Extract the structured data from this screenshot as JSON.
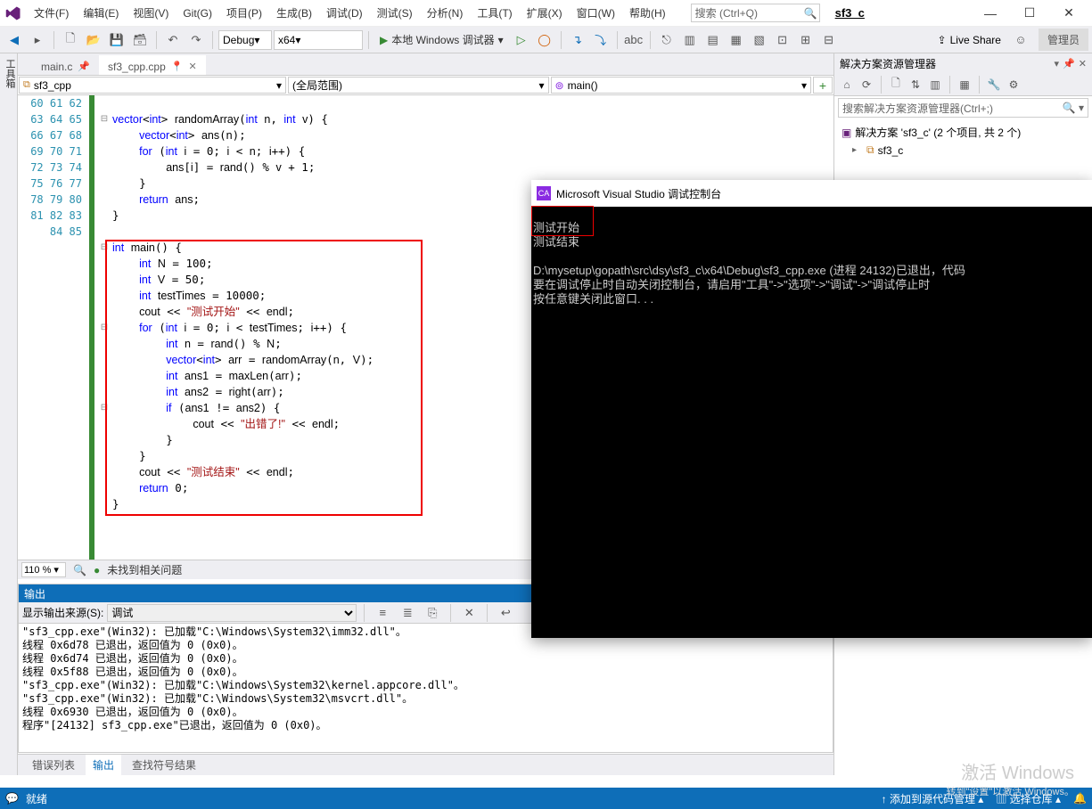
{
  "menu": {
    "file": "文件(F)",
    "edit": "编辑(E)",
    "view": "视图(V)",
    "git": "Git(G)",
    "project": "项目(P)",
    "build": "生成(B)",
    "debug": "调试(D)",
    "test": "测试(S)",
    "analyze": "分析(N)",
    "tools": "工具(T)",
    "extensions": "扩展(X)",
    "window": "窗口(W)",
    "help": "帮助(H)"
  },
  "titlebar": {
    "search_placeholder": "搜索 (Ctrl+Q)",
    "solution_name": "sf3_c"
  },
  "toolbar": {
    "config": "Debug",
    "platform": "x64",
    "run": "本地 Windows 调试器",
    "live_share": "Live Share",
    "admin": "管理员"
  },
  "tabs": {
    "pinned": "main.c",
    "active": "sf3_cpp.cpp"
  },
  "navbar": {
    "project": "sf3_cpp",
    "scope": "(全局范围)",
    "func": "main()"
  },
  "editor": {
    "line_start": 60,
    "line_end": 85,
    "zoom": "110 %",
    "status": "未找到相关问题"
  },
  "code_lines": [
    "",
    "vector<int> randomArray(int n, int v) {",
    "    vector<int> ans(n);",
    "    for (int i = 0; i < n; i++) {",
    "        ans[i] = rand() % v + 1;",
    "    }",
    "    return ans;",
    "}",
    "",
    "int main() {",
    "    int N = 100;",
    "    int V = 50;",
    "    int testTimes = 10000;",
    "    cout << \"测试开始\" << endl;",
    "    for (int i = 0; i < testTimes; i++) {",
    "        int n = rand() % N;",
    "        vector<int> arr = randomArray(n, V);",
    "        int ans1 = maxLen(arr);",
    "        int ans2 = right(arr);",
    "        if (ans1 != ans2) {",
    "            cout << \"出错了!\" << endl;",
    "        }",
    "    }",
    "    cout << \"测试结束\" << endl;",
    "    return 0;",
    "}"
  ],
  "output": {
    "title": "输出",
    "label": "显示输出来源(S):",
    "source": "调试",
    "lines": [
      "\"sf3_cpp.exe\"(Win32): 已加载\"C:\\Windows\\System32\\imm32.dll\"。",
      "线程 0x6d78 已退出，返回值为 0 (0x0)。",
      "线程 0x6d74 已退出，返回值为 0 (0x0)。",
      "线程 0x5f88 已退出，返回值为 0 (0x0)。",
      "\"sf3_cpp.exe\"(Win32): 已加载\"C:\\Windows\\System32\\kernel.appcore.dll\"。",
      "\"sf3_cpp.exe\"(Win32): 已加载\"C:\\Windows\\System32\\msvcrt.dll\"。",
      "线程 0x6930 已退出，返回值为 0 (0x0)。",
      "程序\"[24132] sf3_cpp.exe\"已退出，返回值为 0 (0x0)。"
    ]
  },
  "bottom_tabs": {
    "errors": "错误列表",
    "output": "输出",
    "symbols": "查找符号结果"
  },
  "solution": {
    "title": "解决方案资源管理器",
    "search_placeholder": "搜索解决方案资源管理器(Ctrl+;)",
    "root": "解决方案 'sf3_c' (2 个项目, 共 2 个)",
    "proj": "sf3_c"
  },
  "statusbar": {
    "ready": "就绪",
    "scm": "添加到源代码管理",
    "repo": "选择仓库"
  },
  "console": {
    "title": "Microsoft Visual Studio 调试控制台",
    "out1": "测试开始",
    "out2": "测试结束",
    "exit": "D:\\mysetup\\gopath\\src\\dsy\\sf3_c\\x64\\Debug\\sf3_cpp.exe (进程 24132)已退出，代码",
    "hint1": "要在调试停止时自动关闭控制台，请启用\"工具\"->\"选项\"->\"调试\"->\"调试停止时",
    "hint2": "按任意键关闭此窗口. . ."
  },
  "watermark": {
    "title": "激活 Windows",
    "sub": "转到\"设置\"以激活 Windows。"
  }
}
